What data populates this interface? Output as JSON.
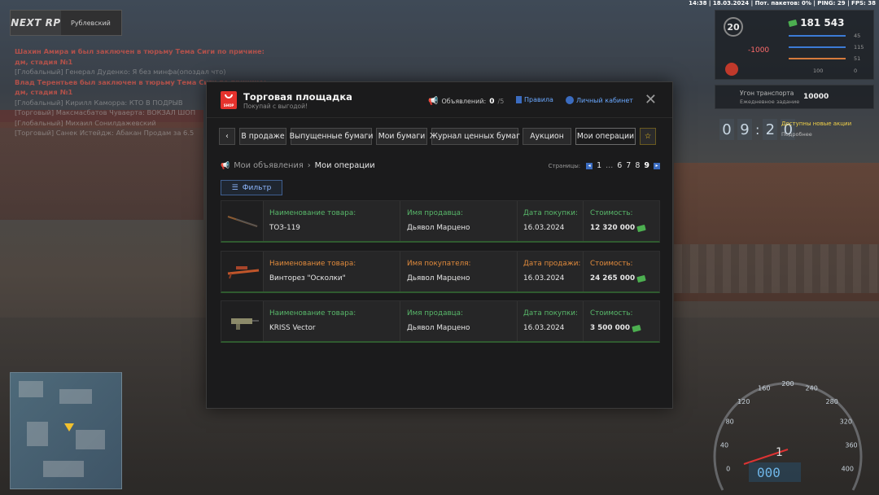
{
  "status_bar": "14:38 | 18.03.2024 | Пот. пакетов: 0% | PING: 29 | FPS: 38",
  "logo": {
    "brand": "NEXT RP",
    "server": "Рублевский"
  },
  "chat": [
    {
      "text": "Шахин Амира и был заключен в тюрьму Тема Сиги по причине: дм, стадия №1",
      "style": "red"
    },
    {
      "text": "[Глобальный] Генерал Дуденко: Я без минфа(опоздал что)",
      "style": "line"
    },
    {
      "text": "Влад Терентьев был заключен в тюрьму Тема Сиги по причине: дм, стадия №1",
      "style": "red"
    },
    {
      "text": "[Глобальный] Кирилл Каморра: КТО В ПОДРЫВ",
      "style": "line"
    },
    {
      "text": "[Торговый] Максмасбатов Чуваерта: ВОКЗАЛ ШОП",
      "style": "line"
    },
    {
      "text": "[Глобальный] Михаил Сонилдажевский",
      "style": "line"
    },
    {
      "text": "[Торговый] Санек Истейдж: Абакан Продам за 6.5",
      "style": "line"
    }
  ],
  "hud": {
    "level": "20",
    "money": "181 543",
    "negative": "-1000",
    "stats": [
      "45",
      "115",
      "51",
      "100",
      "0"
    ],
    "transport_title": "Угон транспорта",
    "transport_sub": "Ежедневное задание",
    "transport_reward": "10000",
    "time_digits": [
      "0",
      "9",
      "2",
      "0"
    ],
    "note": "Доступны новые акции",
    "note_sub": "Подробнее"
  },
  "speedo": {
    "ticks": [
      "0",
      "40",
      "80",
      "120",
      "160",
      "200",
      "240",
      "280",
      "320",
      "360",
      "400"
    ],
    "gear": "1",
    "speed": "000"
  },
  "window": {
    "title": "Торговая площадка",
    "subtitle": "Покупай с выгодой!",
    "logo_text": "SHOP",
    "ads_label": "Объявлений:",
    "ads_count": "0",
    "ads_max": "/5",
    "rules_label": "Правила",
    "cabinet_label": "Личный кабинет",
    "close": "✕",
    "tabs": [
      {
        "label": "В продаже",
        "active": false
      },
      {
        "label": "Выпущенные бумаги",
        "active": false
      },
      {
        "label": "Мои бумаги",
        "active": false
      },
      {
        "label": "Журнал ценных бумаг",
        "active": false
      },
      {
        "label": "Аукцион",
        "active": false
      },
      {
        "label": "Мои операции",
        "active": true
      }
    ],
    "breadcrumb": [
      "Мои объявления",
      "Мои операции"
    ],
    "pages": {
      "label": "Страницы:",
      "items": [
        "1",
        "...",
        "6",
        "7",
        "8",
        "9"
      ],
      "current": "9"
    },
    "filter_label": "Фильтр",
    "rows": [
      {
        "item_h": "Наименование товара:",
        "item_v": "ТОЗ-119",
        "party_h": "Имя продавца:",
        "party_v": "Дьявол Марцено",
        "date_h": "Дата покупки:",
        "date_v": "16.03.2024",
        "cost_h": "Стоимость:",
        "cost_v": "12 320 000",
        "kind": "buy"
      },
      {
        "item_h": "Наименование товара:",
        "item_v": "Винторез \"Осколки\"",
        "party_h": "Имя покупателя:",
        "party_v": "Дьявол Марцено",
        "date_h": "Дата продажи:",
        "date_v": "16.03.2024",
        "cost_h": "Стоимость:",
        "cost_v": "24 265 000",
        "kind": "sell"
      },
      {
        "item_h": "Наименование товара:",
        "item_v": "KRISS Vector",
        "party_h": "Имя продавца:",
        "party_v": "Дьявол Марцено",
        "date_h": "Дата покупки:",
        "date_v": "16.03.2024",
        "cost_h": "Стоимость:",
        "cost_v": "3 500 000",
        "kind": "buy"
      }
    ]
  }
}
